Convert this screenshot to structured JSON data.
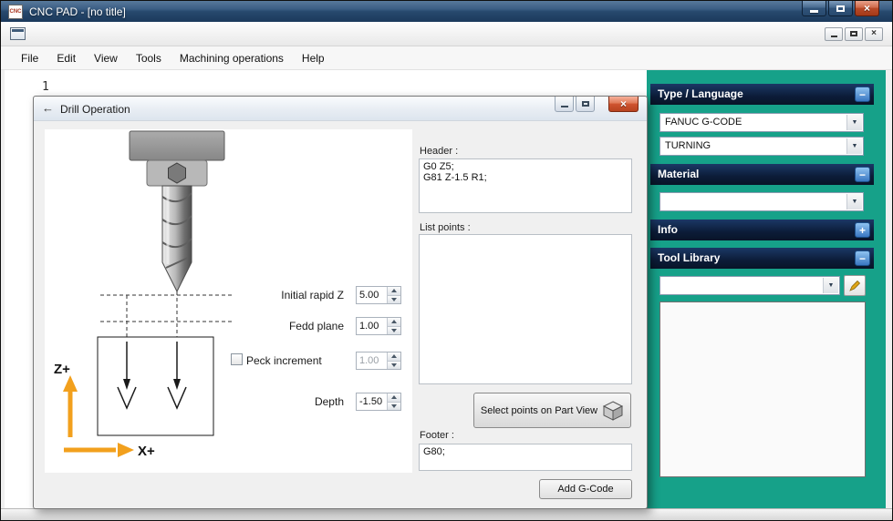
{
  "window": {
    "icon_text": "CNC",
    "title": "CNC PAD - [no title]"
  },
  "menu": {
    "items": [
      "File",
      "Edit",
      "View",
      "Tools",
      "Machining operations",
      "Help"
    ]
  },
  "editor": {
    "line_number": "1"
  },
  "sidebar": {
    "sections": [
      {
        "title": "Type / Language",
        "collapse_icon": "−"
      },
      {
        "title": "Material",
        "collapse_icon": "−"
      },
      {
        "title": "Info",
        "collapse_icon": "+"
      },
      {
        "title": "Tool Library",
        "collapse_icon": "−"
      }
    ],
    "language_combo": "FANUC G-CODE",
    "mode_combo": "TURNING",
    "material_combo": "",
    "tool_combo": ""
  },
  "dialog": {
    "title": "Drill Operation",
    "axes": {
      "z": "Z+",
      "x": "X+"
    },
    "fields": [
      {
        "label": "Initial rapid Z",
        "value": "5.00"
      },
      {
        "label": "Fedd plane",
        "value": "1.00"
      },
      {
        "label": "Peck increment",
        "value": "1.00"
      },
      {
        "label": "Depth",
        "value": "-1.50"
      }
    ],
    "header_label": "Header :",
    "header_value": "G0 Z5;\nG81 Z-1.5 R1;",
    "list_points_label": "List points :",
    "list_points_value": "",
    "select_points_button": "Select points on Part View",
    "footer_label": "Footer :",
    "footer_value": "G80;",
    "add_gcode_button": "Add G-Code"
  },
  "icons": {
    "close": "×",
    "dropdown": "▼",
    "back": "←"
  },
  "colors": {
    "sidebar_teal": "#16a189",
    "section_navy": "#0c1d3a",
    "axis_orange": "#f2a01d",
    "titlebar_blue": "#2f5277",
    "close_red": "#c1512e"
  }
}
